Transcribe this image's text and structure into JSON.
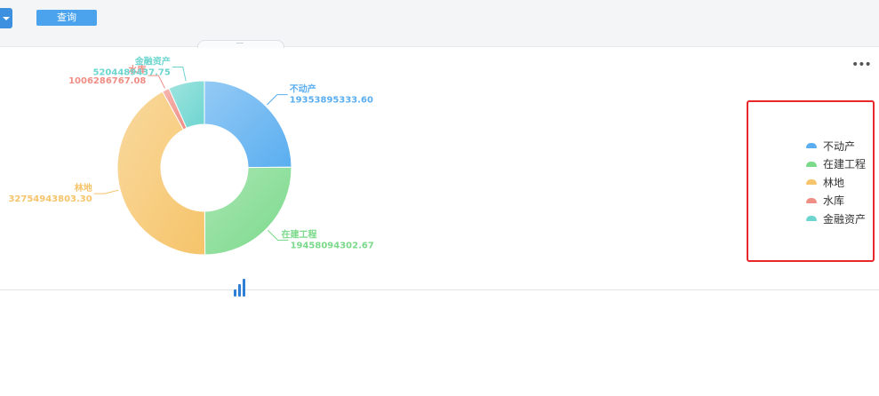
{
  "toolbar": {
    "query_label": "查询"
  },
  "colors": {
    "real_estate": "#5aaef0",
    "construction": "#7ad98a",
    "forest": "#f6c46a",
    "reservoir": "#ef8e85",
    "financial": "#6dd5cf"
  },
  "icons": {
    "more": "more-horizontal-icon",
    "loading": "loading-bars-icon",
    "dropdown": "caret-down-icon"
  },
  "chart_data": {
    "type": "pie",
    "variant": "donut",
    "title": "",
    "categories": [
      "不动产",
      "在建工程",
      "林地",
      "水库",
      "金融资产"
    ],
    "values": [
      19353895333.6,
      19458094302.67,
      32754943803.3,
      1006286767.08,
      5204489437.75
    ],
    "labels": [
      "19353895333.60",
      "19458094302.67",
      "32754943803.30",
      "1006286767.08",
      "5204489437.75"
    ],
    "colors": [
      "#5aaef0",
      "#7ad98a",
      "#f6c46a",
      "#ef8e85",
      "#6dd5cf"
    ],
    "legend": {
      "position": "right",
      "items": [
        "不动产",
        "在建工程",
        "林地",
        "水库",
        "金融资产"
      ]
    }
  }
}
